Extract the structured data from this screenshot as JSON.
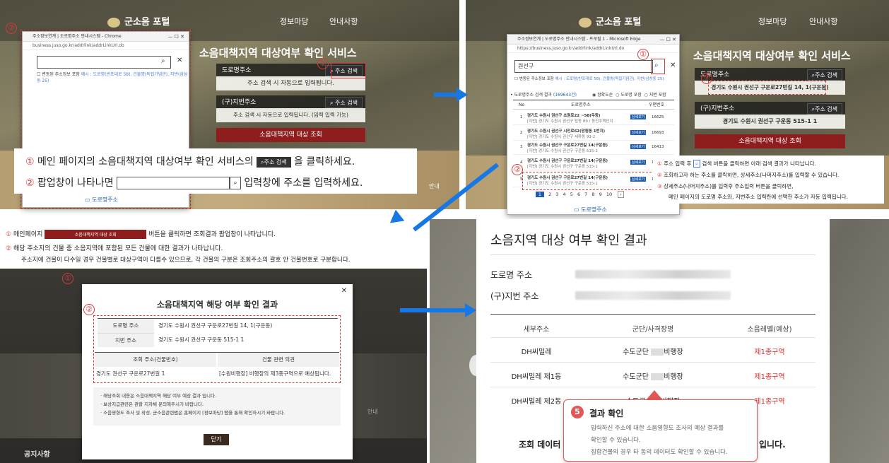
{
  "portal": {
    "logo_text": "군소음 포털",
    "nav": [
      "정보마당",
      "안내사항"
    ]
  },
  "service": {
    "title": "소음대책지역 대상여부 확인 서비스",
    "road_label": "도로명주소",
    "road_btn": "주소 검색",
    "road_hint": "주소 검색 시 자동으로 입력됩니다.",
    "jibun_label": "(구)지번주소",
    "jibun_btn": "주소 검색",
    "jibun_hint": "주소 검색 시 자동으로 입력됩니다. (임력 입력 가능)",
    "lookup_btn": "소음대책지역 대상 조회"
  },
  "popup1": {
    "title": "주소정보연계 | 도로명주소 안내시스템 - Chrome",
    "url": "business.juso.go.kr/addrlink/addrLinkUrl.do",
    "checkbox": "변동된 주소정보 포함",
    "hint": "예시 : 도로명(반포대로 58), 건물명(독립기념관), 지번(삼성동 25)"
  },
  "note1": {
    "line1_a": "메인 페이지의 소음대책지역 대상여부 확인 서비스의",
    "line1_btn": "주소 검색",
    "line1_b": "을 클릭하세요.",
    "line2_a": "팝업창이 나타나면",
    "line2_b": "입력창에 주소를 입력하세요."
  },
  "popup2": {
    "title": "주소정보연계 | 도로명주소 안내시스템 - 프로필 1 - Microsoft Edge",
    "url": "https://business.juso.go.kr/addrlink/addrLinkUrl.do",
    "query": "원선구",
    "checkbox": "변동된 주소정보 포함",
    "hint": "예시 : 도로명(반포대로 58), 건물명(독립기념관), 지번(삼성동 25)",
    "results_label": "도로명주소 검색 결과",
    "results_count": "(169643건)",
    "sort_opts": [
      "정확도순",
      "도로명 포함",
      "지번 포함"
    ],
    "col_no": "No",
    "col_addr": "도로명주소",
    "col_zip": "우편번호",
    "rows": [
      {
        "no": "1",
        "addr": "경기도 수원시 권선구 초원로22 ~58(우등)",
        "sub": "[지번] 경기도 수원시 권선구 탑동 89 / 동신주택단지",
        "zip": "16625"
      },
      {
        "no": "2",
        "addr": "경기도 수원시 권선구 시민로62(망원동 1번지)",
        "sub": "[지번] 경기도 수원시 권선구 세류동 91-2",
        "zip": "16693"
      },
      {
        "no": "3",
        "addr": "경기도 수원시 권선구 구운로27번길 14(구운동)",
        "sub": "[지번] 경기도 수원시 권선구 구운동 515-1",
        "zip": "16413"
      },
      {
        "no": "4",
        "addr": "경기도 수원시 권선구 구운로27번길 14(구운동)",
        "sub": "[지번] 경기도 수원시 권선구 구운동 515-1",
        "zip": "16413"
      },
      {
        "no": "5",
        "addr": "경기도 수원시 권선구 구운로27번길 14(구운동)",
        "sub": "[지번] 경기도 수원시 권선구 구운동 515-1",
        "zip": "16413"
      }
    ],
    "detail_btn": "상세보기",
    "pages": [
      "1",
      "2",
      "3",
      "4",
      "5",
      "6",
      "7",
      "8",
      "9",
      "10"
    ],
    "logo": "도로명주소"
  },
  "service2": {
    "road_value": "경기도 수원시 권선구 구운로27번길 14, 1(구운동)",
    "jibun_value": "경기도 수원시 권선구 구운동 515-1 1"
  },
  "note2": {
    "l1": "주소 입력 후",
    "l1b": "검색 버튼을 클릭하면 아래 검색 결과가 나타납니다.",
    "l2": "조회하고자 하는 주소를 클릭하면, 상세주소(나머지주소)를 입력할 수 있습니다.",
    "l3": "상세주소(나머지주소)를 입력후 주소입력 버튼을 클릭하면,",
    "l4": "메인 페이지의 도로명 주소와, 지번주소 입력란에 선택한 주소가 자동 입력됩니다."
  },
  "note3": {
    "l1a": "메인페이지",
    "l1btn": "소음대책지역 대상 조회",
    "l1b": "버튼을 클릭하면 조회결과 팝업창이 나타납니다.",
    "l2": "해당 주소지의 건물 중 소음지역에 포함된 모든 건물에 대한 결과가 나타납니다.",
    "l3": "주소지에 건물이 다수일 경우 건물별로 대상구역이 다를수 있으므로, 각 건물의 구분은 조회주소의 괄호 안 건물번호로 구분합니다."
  },
  "modal": {
    "title": "소음대책지역 해당 여부 확인 결과",
    "road_label": "도로명 주소",
    "road_value": "경기도 수원시 권선구 구운로27번길 14, 1(구운동)",
    "jibun_label": "지번 주소",
    "jibun_value": "경기도 수원시 권선구 구운동 515-1 1",
    "col1": "조회 주소(건물번호)",
    "col2": "건물 관련 의견",
    "r1c1": "경기도 권선구 구운로27번길 1",
    "r1c2": "[수원비행장] 비행장의 제3종구역으로 예상됩니다.",
    "notes": [
      "해당조회 내용은 소음대책지역 해당 여부 예상 결과 입니다.",
      "보상지급관련은 관할 지자체 문의해주시기 바랍니다.",
      "소음영향도 조사 및 작성, 군소음관련법은 홈페이지 [정보마당] 탭을 통해 확인하시기 바랍니다."
    ],
    "close_btn": "닫기"
  },
  "bottom_left": {
    "notice": "공지사항",
    "guide": "안내"
  },
  "result": {
    "title": "소음지역 대상 여부 확인 결과",
    "road_label": "도로명 주소",
    "jibun_label": "(구)지번 주소",
    "col1": "세부주소",
    "col2": "군단/사격장명",
    "col3": "소음레벨(예상)",
    "rows": [
      {
        "c1": "DH씨밀레",
        "c2a": "수도군단",
        "c2b": "비행장",
        "c3": "제1종구역"
      },
      {
        "c1": "DH씨밀레 제1동",
        "c2a": "수도군단",
        "c2b": "비행장",
        "c3": "제1종구역"
      },
      {
        "c1": "DH씨밀레 제2동",
        "c2a": "수도군",
        "c2b": "비행장",
        "c3": "제1종구역"
      }
    ],
    "footer_a": "조회 데이터",
    "footer_b": "입니다."
  },
  "tooltip": {
    "num": "5",
    "title": "결과 확인",
    "l1": "입력하신 주소에 대한 소음영향도 조사의 예상 결과를",
    "l2": "확인할 수 있습니다.",
    "l3": "집합건물의 경우 타 동의 데이터도 확인할 수 있습니다."
  },
  "colors": {
    "accent_red": "#d43a3a",
    "arrow_blue": "#1677e5",
    "btn_red": "#8e1d1d"
  }
}
